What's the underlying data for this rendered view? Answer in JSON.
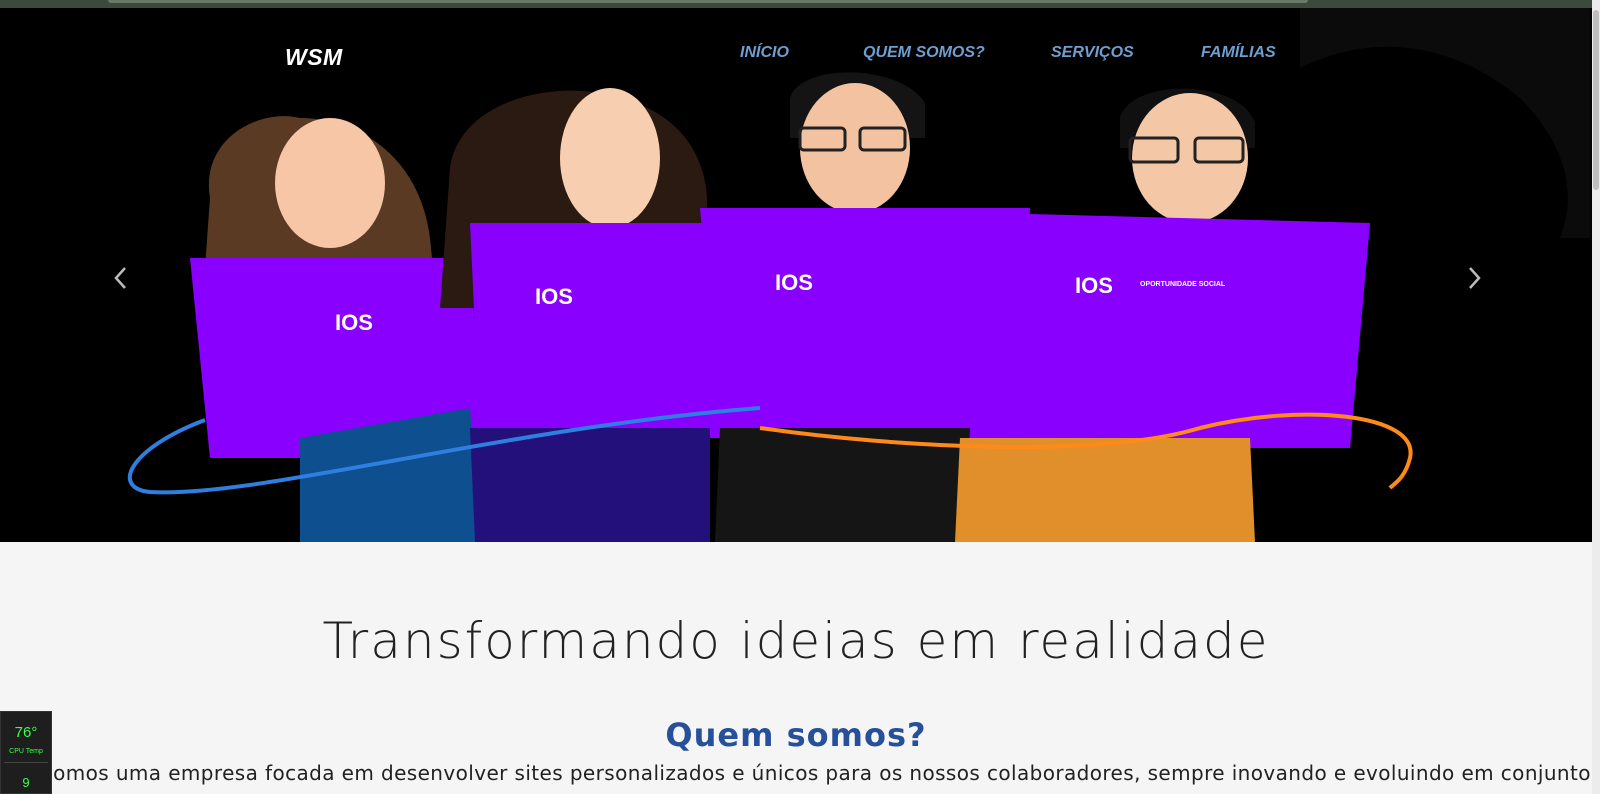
{
  "brand": "WSM",
  "nav": [
    {
      "label": "INÍCIO"
    },
    {
      "label": "QUEM SOMOS?"
    },
    {
      "label": "SERVIÇOS"
    },
    {
      "label": "FAMÍLIAS"
    }
  ],
  "hero": {
    "shirt_text": "IOS",
    "shirt_subtext": "OPORTUNIDADE SOCIAL",
    "colors": {
      "shirt": "#8a00ff",
      "accent_blue": "#2f7fe0",
      "accent_orange": "#ff8a1a"
    }
  },
  "carousel": {
    "prev_icon": "chevron-left-icon",
    "next_icon": "chevron-right-icon"
  },
  "headline": "Transformando ideias em realidade",
  "about": {
    "title": "Quem somos?",
    "text": "Somos uma empresa focada em desenvolver sites personalizados e únicos para os nossos colaboradores, sempre inovando e evoluindo em conjunto."
  },
  "widget": {
    "temp": "76°",
    "label": "CPU Temp",
    "value2": "9"
  }
}
